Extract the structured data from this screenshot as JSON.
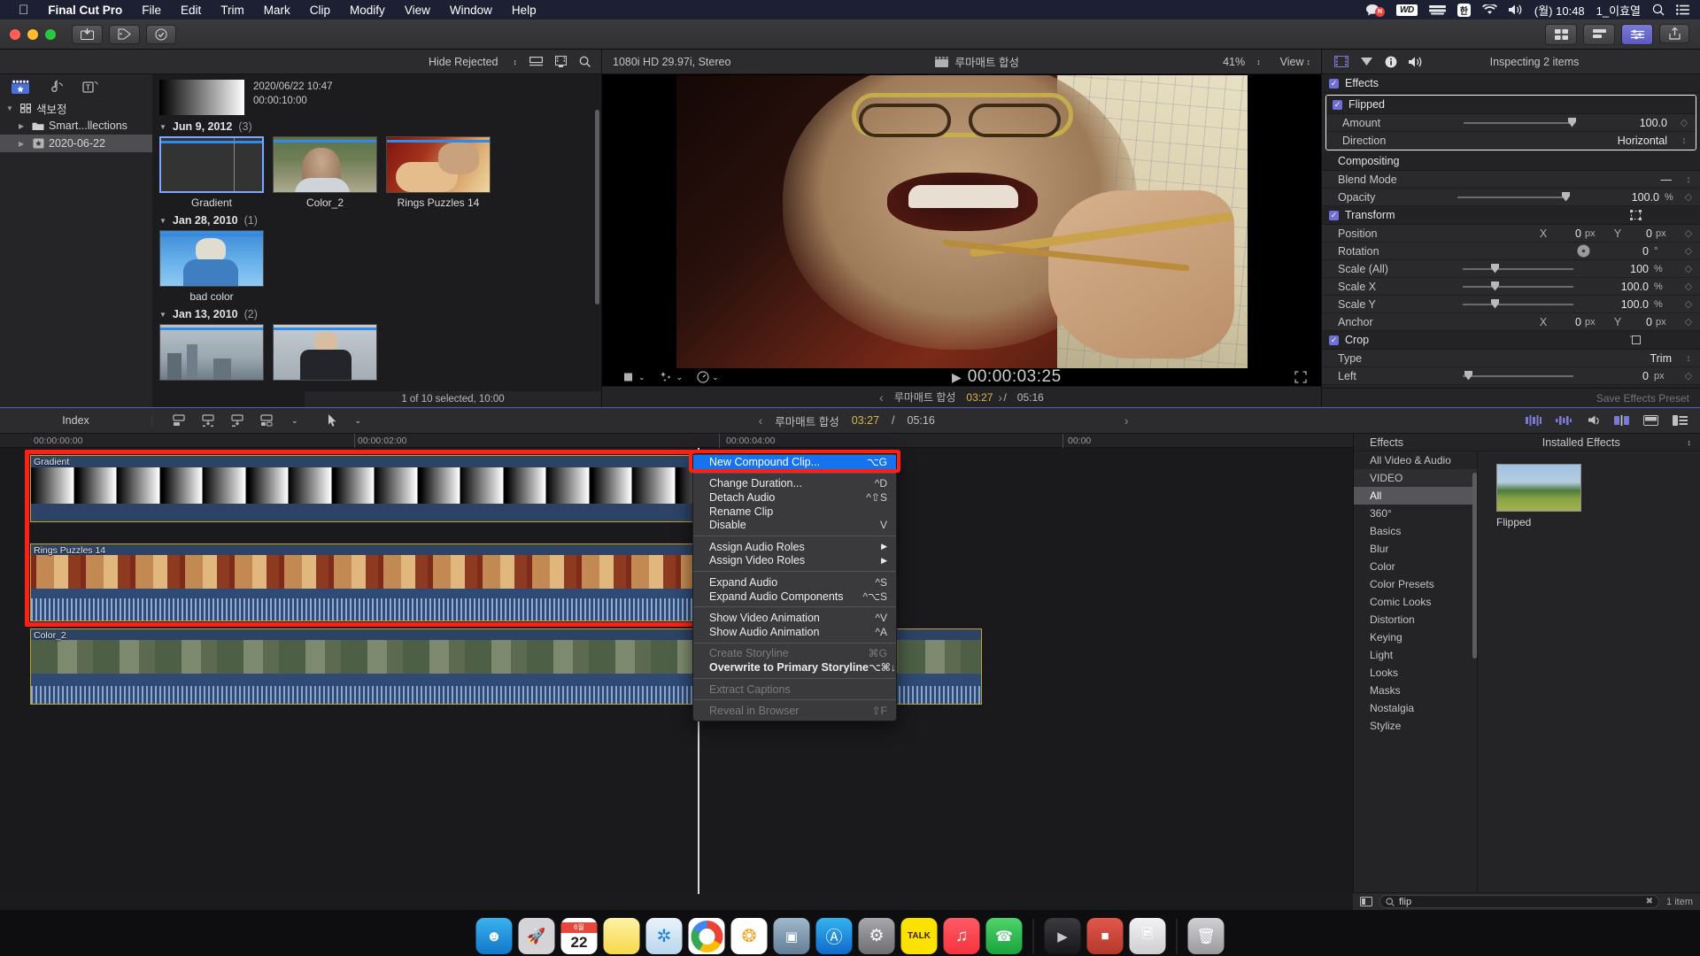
{
  "menubar": {
    "apple": "&#63743;",
    "items": [
      "Final Cut Pro",
      "File",
      "Edit",
      "Trim",
      "Mark",
      "Clip",
      "Modify",
      "View",
      "Window",
      "Help"
    ],
    "right": {
      "chat_badge": "N",
      "wd_label": "WD",
      "input_label": "한",
      "clock": "(월) 10:48",
      "user": "1_이효열"
    }
  },
  "toolbar": {
    "media_import_icon": "media-import",
    "keyword_icon": "keyword",
    "background_tasks_icon": "background-tasks"
  },
  "browser": {
    "toolbar": {
      "hide_rejected": "Hide Rejected",
      "clip_appearance_icon": "clip-appearance",
      "filmstrip_view_icon": "filmstrip-view",
      "search_icon": "search"
    },
    "sidebar": [
      {
        "label": "색보정",
        "icon": "library-icon",
        "level": 0,
        "selected": false
      },
      {
        "label": "Smart...llections",
        "icon": "folder-icon",
        "level": 1,
        "selected": false
      },
      {
        "label": "2020-06-22",
        "icon": "event-icon",
        "level": 1,
        "selected": true
      }
    ],
    "top_clip": {
      "date": "2020/06/22 10:47",
      "duration": "00:00:10:00"
    },
    "groups": [
      {
        "title": "Jun 9, 2012",
        "count": "(3)",
        "clips": [
          {
            "name": "Gradient",
            "kind": "gradient",
            "selected": true
          },
          {
            "name": "Color_2",
            "kind": "man-outdoor",
            "selected": false
          },
          {
            "name": "Rings Puzzles 14",
            "kind": "man-rings",
            "selected": false
          }
        ]
      },
      {
        "title": "Jan 28, 2010",
        "count": "(1)",
        "clips": [
          {
            "name": "bad color",
            "kind": "blue-person",
            "selected": false
          }
        ]
      },
      {
        "title": "Jan 13, 2010",
        "count": "(2)",
        "clips": [
          {
            "name": "",
            "kind": "city",
            "selected": false
          },
          {
            "name": "",
            "kind": "suit-man",
            "selected": false
          }
        ]
      }
    ],
    "status": "1 of 10 selected, 10:00"
  },
  "viewer": {
    "format": "1080i HD 29.97i, Stereo",
    "project_name": "루마매트 합성",
    "zoom": "41%",
    "view_label": "View",
    "timecode": "00:00:03:25",
    "play_icon": "play",
    "transform_icon": "transform-tool",
    "effects_icon": "effects-tool",
    "retime_icon": "retiming",
    "fullscreen_icon": "fullscreen",
    "strip": {
      "prev_icon": "chevron-left",
      "title": "루마매트 합성",
      "current": "03:27",
      "sep": "/",
      "total": "05:16",
      "next_icon": "chevron-right"
    }
  },
  "inspector": {
    "tabs": [
      "video-icon",
      "info-triangle-icon",
      "info-icon",
      "audio-icon"
    ],
    "title": "Inspecting 2 items",
    "sections": [
      {
        "name": "Effects",
        "checked": true,
        "highlighted_effect": {
          "name": "Flipped",
          "checked": true,
          "rows": [
            {
              "label": "Amount",
              "value": "100.0",
              "unit": "",
              "slider": 96
            },
            {
              "label": "Direction",
              "value": "Horizontal",
              "unit": "",
              "popup": true
            }
          ]
        }
      },
      {
        "name": "Compositing",
        "checked": false,
        "rows": [
          {
            "label": "Blend Mode",
            "value": "—",
            "popup": true
          },
          {
            "label": "Opacity",
            "value": "100.0",
            "unit": "%",
            "slider": 96
          }
        ]
      },
      {
        "name": "Transform",
        "checked": true,
        "reset_icon": "transform-reset",
        "rows": [
          {
            "label": "Position",
            "axis_x": "X",
            "vx": "0",
            "unit_x": "px",
            "axis_y": "Y",
            "vy": "0",
            "unit_y": "px"
          },
          {
            "label": "Rotation",
            "value": "0",
            "unit": "°",
            "dial": true
          },
          {
            "label": "Scale (All)",
            "value": "100",
            "unit": "%",
            "slider": 26
          },
          {
            "label": "Scale X",
            "value": "100.0",
            "unit": "%",
            "slider": 26
          },
          {
            "label": "Scale Y",
            "value": "100.0",
            "unit": "%",
            "slider": 26
          },
          {
            "label": "Anchor",
            "axis_x": "X",
            "vx": "0",
            "unit_x": "px",
            "axis_y": "Y",
            "vy": "0",
            "unit_y": "px"
          }
        ]
      },
      {
        "name": "Crop",
        "checked": true,
        "reset_icon": "crop-reset",
        "rows": [
          {
            "label": "Type",
            "value": "Trim",
            "popup": true
          },
          {
            "label": "Left",
            "value": "0",
            "unit": "px",
            "slider": 3
          }
        ]
      }
    ],
    "save_preset": "Save Effects Preset"
  },
  "timeline_bar": {
    "index": "Index",
    "tools": [
      "append-icon",
      "insert-icon",
      "connect-icon",
      "overwrite-icon",
      "select-tool-icon"
    ],
    "center": {
      "prev_icon": "chevron-left",
      "title": "루마매트 합성",
      "current": "03:27",
      "sep": "/",
      "total": "05:16",
      "next_icon": "chevron-right"
    },
    "right_icons": [
      "skimming-icon",
      "audio-skim-icon",
      "solo-icon",
      "snapping-icon",
      "clip-appearance-icon",
      "timeline-index-icon"
    ]
  },
  "timeline": {
    "ruler_marks": [
      "00:00:00:00",
      "00:00:02:00",
      "00:00:04:00",
      "00:00"
    ],
    "clips": [
      {
        "name": "Gradient",
        "kind": "gradient",
        "selected": true
      },
      {
        "name": "Rings Puzzles 14",
        "kind": "rings",
        "selected": true
      },
      {
        "name": "Color_2",
        "kind": "color2",
        "selected": false
      }
    ]
  },
  "effects_browser": {
    "header_left": "Effects",
    "header_right": "Installed Effects",
    "categories": [
      {
        "label": "All Video & Audio",
        "type": "item"
      },
      {
        "label": "VIDEO",
        "type": "cat"
      },
      {
        "label": "All",
        "type": "item",
        "selected": true
      },
      {
        "label": "360°",
        "type": "item"
      },
      {
        "label": "Basics",
        "type": "item"
      },
      {
        "label": "Blur",
        "type": "item"
      },
      {
        "label": "Color",
        "type": "item"
      },
      {
        "label": "Color Presets",
        "type": "item"
      },
      {
        "label": "Comic Looks",
        "type": "item"
      },
      {
        "label": "Distortion",
        "type": "item"
      },
      {
        "label": "Keying",
        "type": "item"
      },
      {
        "label": "Light",
        "type": "item"
      },
      {
        "label": "Looks",
        "type": "item"
      },
      {
        "label": "Masks",
        "type": "item"
      },
      {
        "label": "Nostalgia",
        "type": "item"
      },
      {
        "label": "Stylize",
        "type": "item"
      }
    ],
    "results": [
      {
        "name": "Flipped"
      }
    ],
    "search": {
      "value": "flip",
      "placeholder": "Search",
      "clear_icon": "clear-icon",
      "search_icon": "search-icon"
    },
    "count": "1 item"
  },
  "context_menu": {
    "items": [
      {
        "label": "New Compound Clip...",
        "shortcut": "⌥G",
        "state": "highlight"
      },
      {
        "type": "sep"
      },
      {
        "label": "Change Duration...",
        "shortcut": "^D",
        "state": "normal"
      },
      {
        "label": "Detach Audio",
        "shortcut": "^⇧S",
        "state": "normal"
      },
      {
        "label": "Rename Clip",
        "shortcut": "",
        "state": "normal"
      },
      {
        "label": "Disable",
        "shortcut": "V",
        "state": "normal"
      },
      {
        "type": "sep"
      },
      {
        "label": "Assign Audio Roles",
        "shortcut": "",
        "state": "submenu"
      },
      {
        "label": "Assign Video Roles",
        "shortcut": "",
        "state": "submenu"
      },
      {
        "type": "sep"
      },
      {
        "label": "Expand Audio",
        "shortcut": "^S",
        "state": "normal"
      },
      {
        "label": "Expand Audio Components",
        "shortcut": "^⌥S",
        "state": "normal"
      },
      {
        "type": "sep"
      },
      {
        "label": "Show Video Animation",
        "shortcut": "^V",
        "state": "normal"
      },
      {
        "label": "Show Audio Animation",
        "shortcut": "^A",
        "state": "normal"
      },
      {
        "type": "sep"
      },
      {
        "label": "Create Storyline",
        "shortcut": "⌘G",
        "state": "disabled"
      },
      {
        "label": "Overwrite to Primary Storyline",
        "shortcut": "⌥⌘↓",
        "state": "bold"
      },
      {
        "type": "sep"
      },
      {
        "label": "Extract Captions",
        "shortcut": "",
        "state": "disabled"
      },
      {
        "type": "sep"
      },
      {
        "label": "Reveal in Browser",
        "shortcut": "⇧F",
        "state": "disabled"
      }
    ]
  },
  "dock": {
    "items": [
      {
        "name": "finder",
        "glyph": "🙂",
        "color": "#1e8ae5"
      },
      {
        "name": "launchpad",
        "glyph": "🚀",
        "color": "#d8d8da"
      },
      {
        "name": "calendar",
        "glyph": "22",
        "color": "#ffffff"
      },
      {
        "name": "notes",
        "glyph": "📝",
        "color": "#fbe14c"
      },
      {
        "name": "safari",
        "glyph": "🧭",
        "color": "#1fa3f0"
      },
      {
        "name": "chrome",
        "glyph": "◉",
        "color": "#ffffff"
      },
      {
        "name": "photos",
        "glyph": "✹",
        "color": "#ffffff"
      },
      {
        "name": "screenshot",
        "glyph": "▣",
        "color": "#6f8ba3"
      },
      {
        "name": "app-store",
        "glyph": "Ⓐ",
        "color": "#2b8cf0"
      },
      {
        "name": "system-preferences",
        "glyph": "⚙",
        "color": "#8e8e93"
      },
      {
        "name": "kakaotalk",
        "glyph": "TALK",
        "color": "#fae100"
      },
      {
        "name": "music",
        "glyph": "♫",
        "color": "#fc3c44"
      },
      {
        "name": "facetime",
        "glyph": "📞",
        "color": "#35c759"
      },
      {
        "name": "final-cut-pro",
        "glyph": "▶",
        "color": "#2b2b2d"
      },
      {
        "name": "compressor",
        "glyph": "■",
        "color": "#d04a3a"
      },
      {
        "name": "preview",
        "glyph": "🖼",
        "color": "#e8e8ea"
      },
      {
        "name": "trash",
        "glyph": "🗑",
        "color": "#c8c8ca"
      }
    ],
    "calendar": {
      "month": "6월",
      "day": "22"
    }
  }
}
